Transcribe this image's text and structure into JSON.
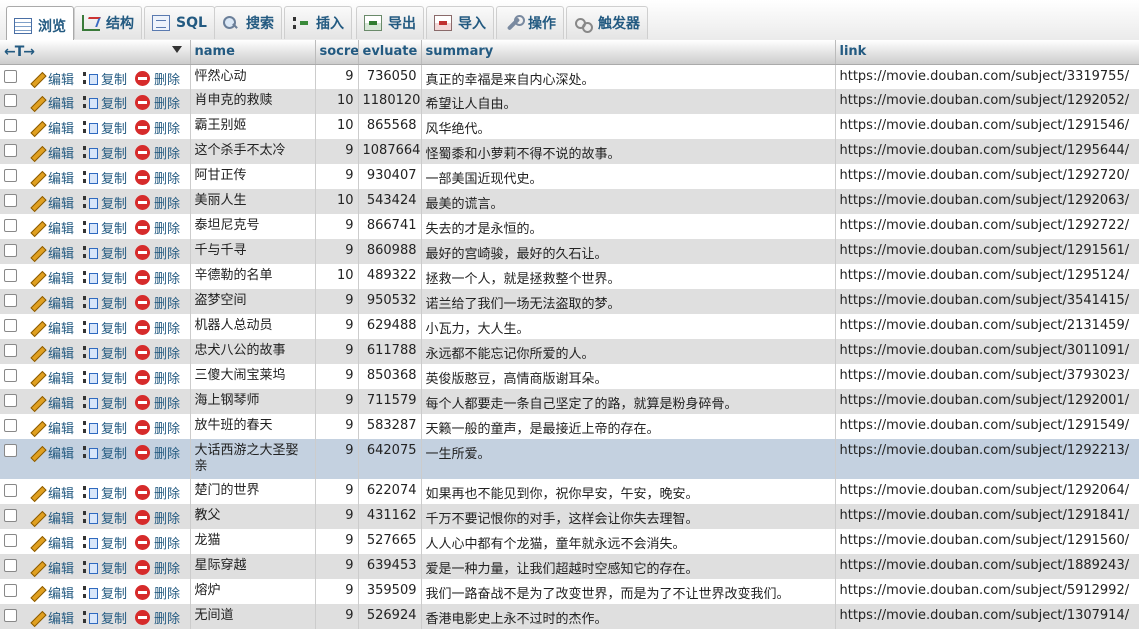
{
  "tabs": [
    {
      "label": "浏览",
      "icon": "browse-icon",
      "active": true
    },
    {
      "label": "结构",
      "icon": "structure-icon"
    },
    {
      "label": "SQL",
      "icon": "sql-icon"
    },
    {
      "label": "搜索",
      "icon": "search-icon"
    },
    {
      "label": "插入",
      "icon": "insert-icon"
    },
    {
      "label": "导出",
      "icon": "export-icon"
    },
    {
      "label": "导入",
      "icon": "import-icon"
    },
    {
      "label": "操作",
      "icon": "operations-icon"
    },
    {
      "label": "触发器",
      "icon": "trigger-icon"
    }
  ],
  "table": {
    "arrows": "←T→",
    "columns": [
      "name",
      "socre",
      "evluate",
      "summary",
      "link"
    ],
    "actions": {
      "edit": "编辑",
      "copy": "复制",
      "delete": "删除"
    },
    "rows": [
      {
        "name": "怦然心动",
        "socre": "9",
        "evluate": "736050",
        "summary": "真正的幸福是来自内心深处。",
        "link": "https://movie.douban.com/subject/3319755/"
      },
      {
        "name": "肖申克的救赎",
        "socre": "10",
        "evluate": "1180120",
        "summary": "希望让人自由。",
        "link": "https://movie.douban.com/subject/1292052/"
      },
      {
        "name": "霸王别姬",
        "socre": "10",
        "evluate": "865568",
        "summary": "风华绝代。",
        "link": "https://movie.douban.com/subject/1291546/"
      },
      {
        "name": "这个杀手不太冷",
        "socre": "9",
        "evluate": "1087664",
        "summary": "怪蜀黍和小萝莉不得不说的故事。",
        "link": "https://movie.douban.com/subject/1295644/"
      },
      {
        "name": "阿甘正传",
        "socre": "9",
        "evluate": "930407",
        "summary": "一部美国近现代史。",
        "link": "https://movie.douban.com/subject/1292720/"
      },
      {
        "name": "美丽人生",
        "socre": "10",
        "evluate": "543424",
        "summary": "最美的谎言。",
        "link": "https://movie.douban.com/subject/1292063/"
      },
      {
        "name": "泰坦尼克号",
        "socre": "9",
        "evluate": "866741",
        "summary": "失去的才是永恒的。",
        "link": "https://movie.douban.com/subject/1292722/"
      },
      {
        "name": "千与千寻",
        "socre": "9",
        "evluate": "860988",
        "summary": "最好的宫崎骏，最好的久石让。",
        "link": "https://movie.douban.com/subject/1291561/"
      },
      {
        "name": "辛德勒的名单",
        "socre": "10",
        "evluate": "489322",
        "summary": "拯救一个人，就是拯救整个世界。",
        "link": "https://movie.douban.com/subject/1295124/"
      },
      {
        "name": "盗梦空间",
        "socre": "9",
        "evluate": "950532",
        "summary": "诺兰给了我们一场无法盗取的梦。",
        "link": "https://movie.douban.com/subject/3541415/"
      },
      {
        "name": "机器人总动员",
        "socre": "9",
        "evluate": "629488",
        "summary": "小瓦力，大人生。",
        "link": "https://movie.douban.com/subject/2131459/"
      },
      {
        "name": "忠犬八公的故事",
        "socre": "9",
        "evluate": "611788",
        "summary": "永远都不能忘记你所爱的人。",
        "link": "https://movie.douban.com/subject/3011091/"
      },
      {
        "name": "三傻大闹宝莱坞",
        "socre": "9",
        "evluate": "850368",
        "summary": "英俊版憨豆，高情商版谢耳朵。",
        "link": "https://movie.douban.com/subject/3793023/"
      },
      {
        "name": "海上钢琴师",
        "socre": "9",
        "evluate": "711579",
        "summary": "每个人都要走一条自己坚定了的路，就算是粉身碎骨。",
        "link": "https://movie.douban.com/subject/1292001/"
      },
      {
        "name": "放牛班的春天",
        "socre": "9",
        "evluate": "583287",
        "summary": "天籁一般的童声，是最接近上帝的存在。",
        "link": "https://movie.douban.com/subject/1291549/"
      },
      {
        "name": "大话西游之大圣娶亲",
        "socre": "9",
        "evluate": "642075",
        "summary": "一生所爱。",
        "link": "https://movie.douban.com/subject/1292213/",
        "selected": true
      },
      {
        "name": "楚门的世界",
        "socre": "9",
        "evluate": "622074",
        "summary": "如果再也不能见到你，祝你早安，午安，晚安。",
        "link": "https://movie.douban.com/subject/1292064/"
      },
      {
        "name": "教父",
        "socre": "9",
        "evluate": "431162",
        "summary": "千万不要记恨你的对手，这样会让你失去理智。",
        "link": "https://movie.douban.com/subject/1291841/"
      },
      {
        "name": "龙猫",
        "socre": "9",
        "evluate": "527665",
        "summary": "人人心中都有个龙猫，童年就永远不会消失。",
        "link": "https://movie.douban.com/subject/1291560/"
      },
      {
        "name": "星际穿越",
        "socre": "9",
        "evluate": "639453",
        "summary": "爱是一种力量，让我们超越时空感知它的存在。",
        "link": "https://movie.douban.com/subject/1889243/"
      },
      {
        "name": "熔炉",
        "socre": "9",
        "evluate": "359509",
        "summary": "我们一路奋战不是为了改变世界，而是为了不让世界改变我们。",
        "link": "https://movie.douban.com/subject/5912992/"
      },
      {
        "name": "无间道",
        "socre": "9",
        "evluate": "526924",
        "summary": "香港电影史上永不过时的杰作。",
        "link": "https://movie.douban.com/subject/1307914/"
      }
    ]
  }
}
